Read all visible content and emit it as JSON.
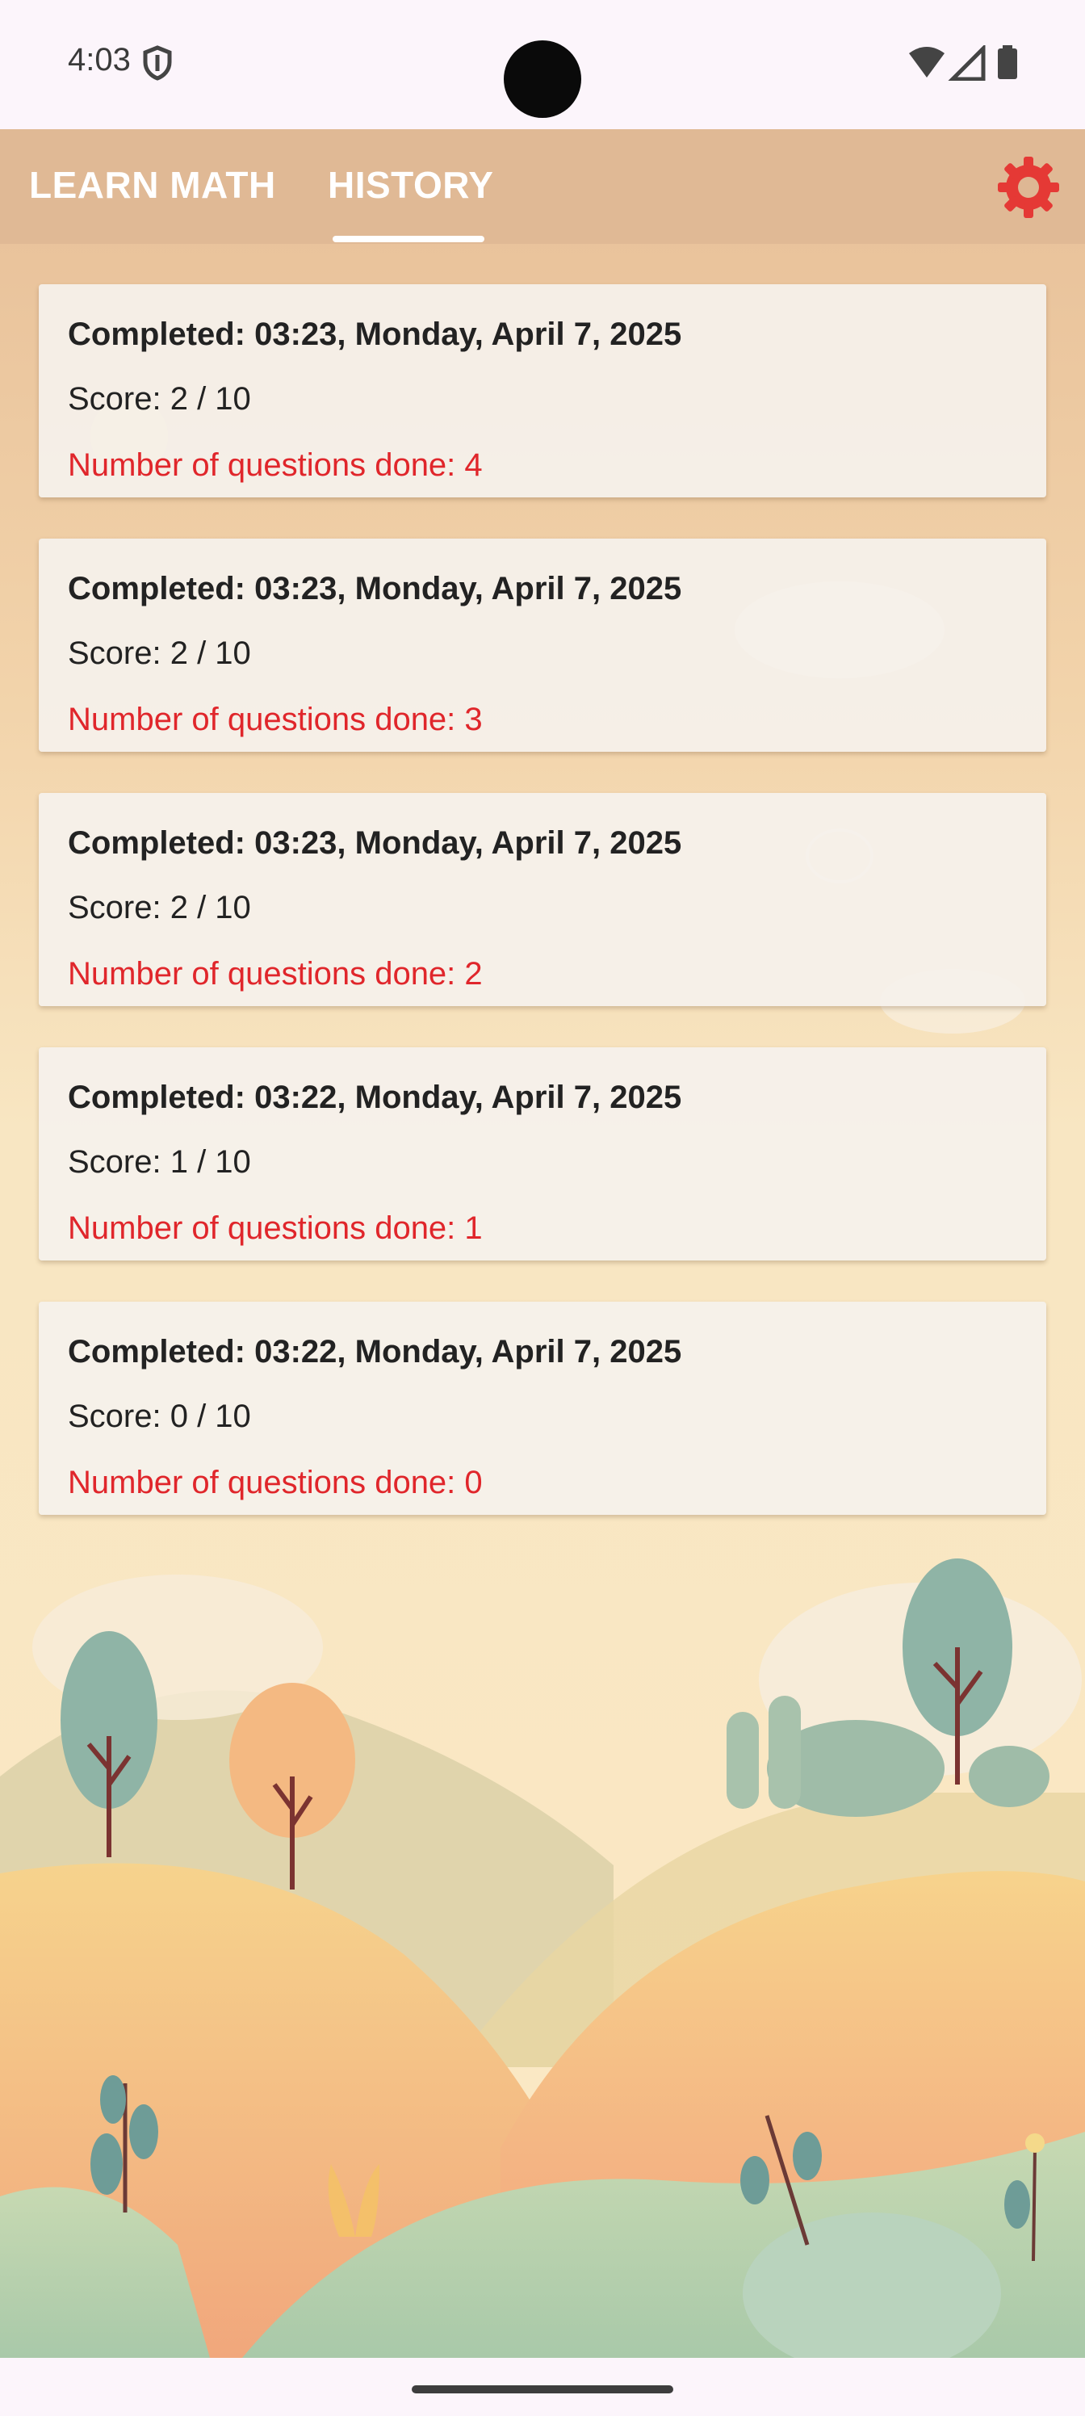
{
  "status_bar": {
    "time": "4:03",
    "icons": [
      "shield-icon",
      "wifi-icon",
      "cell-signal-icon",
      "battery-icon"
    ]
  },
  "tabs": [
    {
      "label": "LEARN MATH",
      "selected": false
    },
    {
      "label": "HISTORY",
      "selected": true
    }
  ],
  "toolbar": {
    "settings_icon": "gear-icon",
    "settings_color": "#e53935"
  },
  "history": [
    {
      "completed": "Completed: 03:23, Monday, April 7, 2025",
      "score": "Score: 2 / 10",
      "questions": "Number of questions done: 4"
    },
    {
      "completed": "Completed: 03:23, Monday, April 7, 2025",
      "score": "Score: 2 / 10",
      "questions": "Number of questions done: 3"
    },
    {
      "completed": "Completed: 03:23, Monday, April 7, 2025",
      "score": "Score: 2 / 10",
      "questions": "Number of questions done: 2"
    },
    {
      "completed": "Completed: 03:22, Monday, April 7, 2025",
      "score": "Score: 1 / 10",
      "questions": "Number of questions done: 1"
    },
    {
      "completed": "Completed: 03:22, Monday, April 7, 2025",
      "score": "Score: 0 / 10",
      "questions": "Number of questions done: 0"
    }
  ],
  "colors": {
    "accent_red": "#e0262b",
    "tab_bar": "#deb794",
    "card": "#f5f1ec"
  }
}
